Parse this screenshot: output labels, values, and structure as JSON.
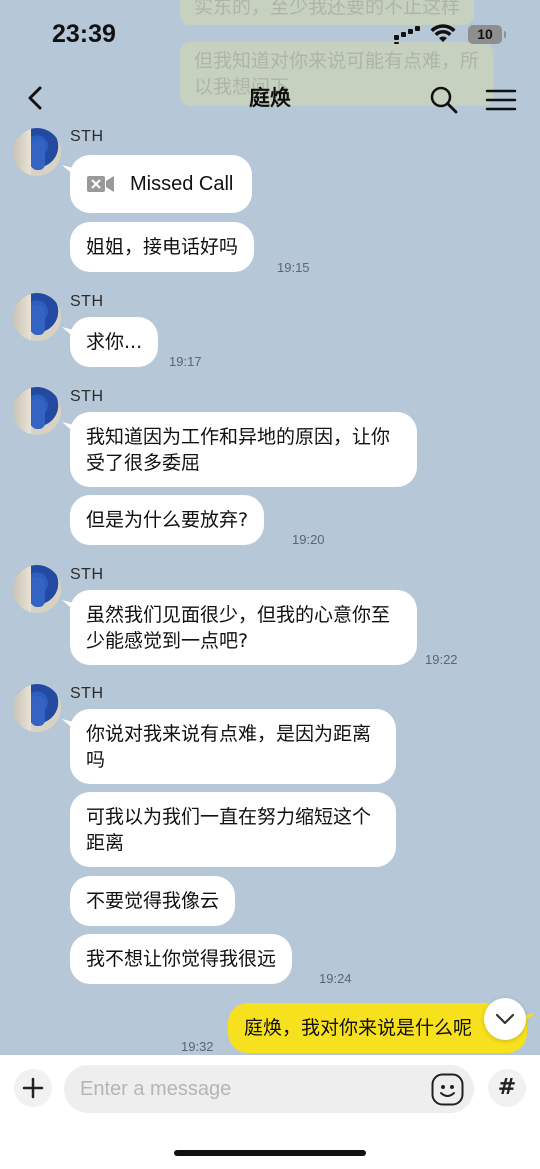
{
  "status_bar": {
    "time": "23:39",
    "battery": "10"
  },
  "header": {
    "title": "庭焕"
  },
  "ghost_messages": [
    "实东的，至少我还要的不止这样",
    "但我知道对你来说可能有点难，所",
    "以我想问下"
  ],
  "groups": [
    {
      "sender": "STH",
      "messages": [
        {
          "type": "call",
          "text": "Missed Call"
        },
        {
          "text": "姐姐，接电话好吗"
        }
      ],
      "time": "19:15"
    },
    {
      "sender": "STH",
      "messages": [
        {
          "text": "求你..."
        }
      ],
      "time": "19:17"
    },
    {
      "sender": "STH",
      "messages": [
        {
          "text": "我知道因为工作和异地的原因，让你受了很多委屈"
        },
        {
          "text": "但是为什么要放弃?"
        }
      ],
      "time": "19:20"
    },
    {
      "sender": "STH",
      "messages": [
        {
          "text": "虽然我们见面很少，但我的心意你至少能感觉到一点吧?"
        }
      ],
      "time": "19:22"
    },
    {
      "sender": "STH",
      "messages": [
        {
          "text": "你说对我来说有点难，是因为距离吗"
        },
        {
          "text": "可我以为我们一直在努力缩短这个距离"
        },
        {
          "text": "不要觉得我像云"
        },
        {
          "text": "我不想让你觉得我很远"
        }
      ],
      "time": "19:24"
    }
  ],
  "my_message": {
    "text": "庭焕，我对你来说是什么呢",
    "time": "19:32"
  },
  "input": {
    "placeholder": "Enter a message",
    "value": ""
  },
  "icons": {
    "back": "chevron-left-icon",
    "search": "search-icon",
    "menu": "menu-icon",
    "call": "video-call-missed-icon",
    "scroll": "chevron-down-icon",
    "plus": "plus-icon",
    "emoji": "emoji-icon",
    "hash": "hash-icon"
  },
  "hash_symbol": "#",
  "colors": {
    "background": "#b6c7d7",
    "my_bubble": "#f7e01d",
    "their_bubble": "#ffffff"
  }
}
